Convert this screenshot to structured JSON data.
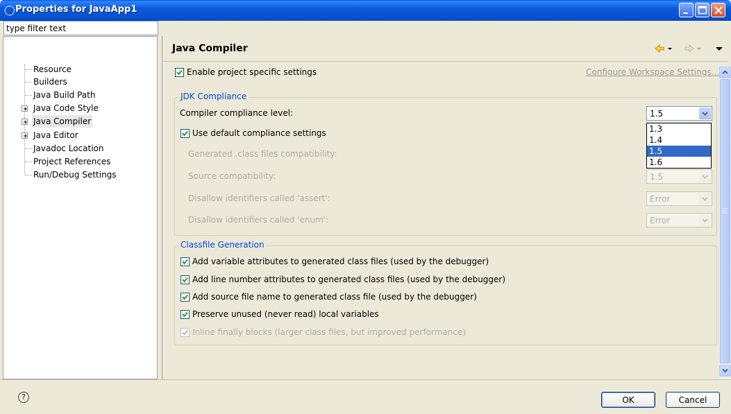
{
  "window": {
    "title": "Properties for JavaApp1",
    "icon": "eclipse-icon"
  },
  "filter": {
    "value": "type filter text"
  },
  "tree": [
    {
      "label": "Resource",
      "expandable": false
    },
    {
      "label": "Builders",
      "expandable": false
    },
    {
      "label": "Java Build Path",
      "expandable": false
    },
    {
      "label": "Java Code Style",
      "expandable": true
    },
    {
      "label": "Java Compiler",
      "expandable": true,
      "selected": true
    },
    {
      "label": "Java Editor",
      "expandable": true
    },
    {
      "label": "Javadoc Location",
      "expandable": false
    },
    {
      "label": "Project References",
      "expandable": false
    },
    {
      "label": "Run/Debug Settings",
      "expandable": false
    }
  ],
  "page": {
    "title": "Java Compiler",
    "enable_specific": "Enable project specific settings",
    "configure_link": "Configure Workspace Settings...",
    "jdk": {
      "legend": "JDK Compliance",
      "compliance_label": "Compiler compliance level:",
      "compliance_value": "1.5",
      "options": [
        "1.3",
        "1.4",
        "1.5",
        "1.6"
      ],
      "use_default": "Use default compliance settings",
      "generated_label": "Generated .class files compatibility:",
      "source_label": "Source compatibility:",
      "source_value": "1.5",
      "assert_label": "Disallow identifiers called 'assert':",
      "assert_value": "Error",
      "enum_label": "Disallow identifiers called 'enum':",
      "enum_value": "Error"
    },
    "classfile": {
      "legend": "Classfile Generation",
      "opt1": "Add variable attributes to generated class files (used by the debugger)",
      "opt2": "Add line number attributes to generated class files (used by the debugger)",
      "opt3": "Add source file name to generated class file (used by the debugger)",
      "opt4": "Preserve unused (never read) local variables",
      "opt5": "Inline finally blocks (larger class files, but improved performance)"
    }
  },
  "buttons": {
    "ok": "OK",
    "cancel": "Cancel",
    "help": "?"
  },
  "colors": {
    "titlebar": "#0b5bd8",
    "selection": "#316ac5",
    "legend": "#0046d5"
  }
}
